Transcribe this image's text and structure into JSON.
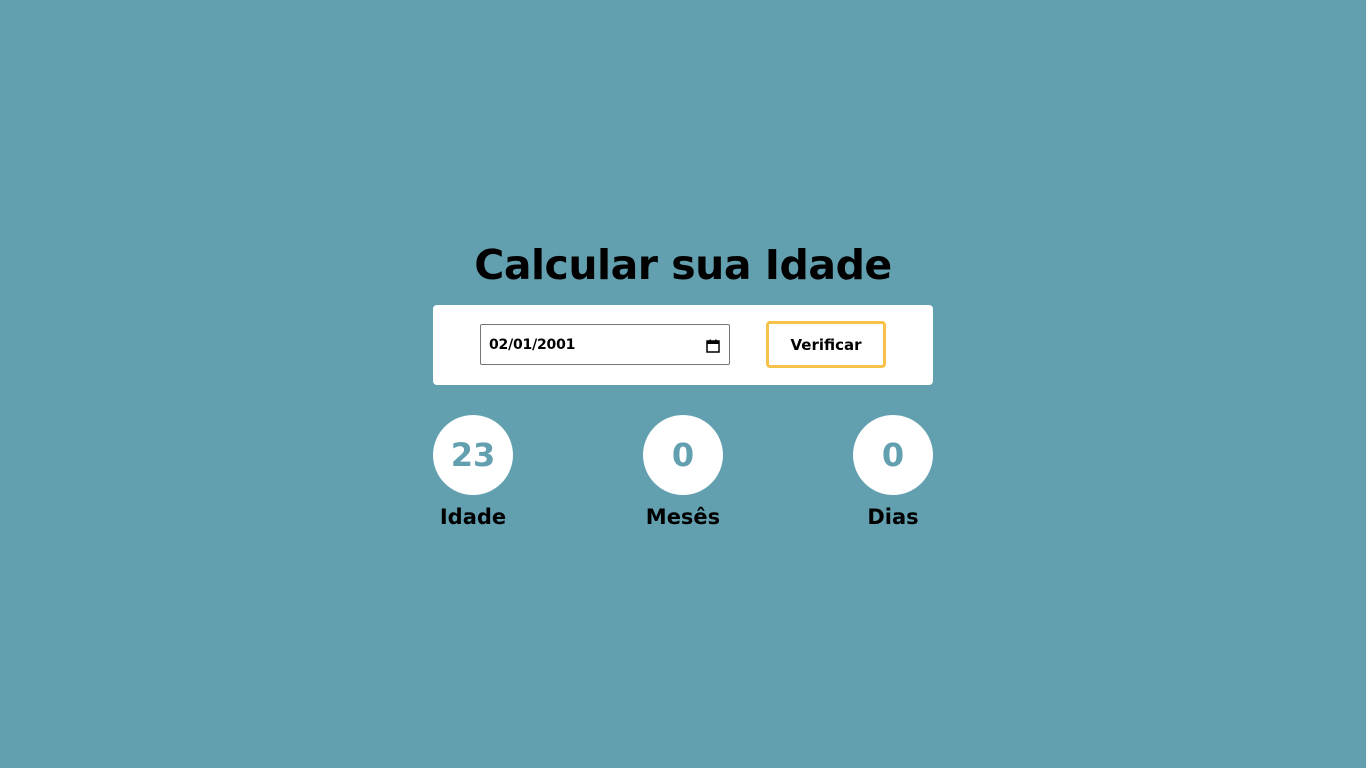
{
  "page": {
    "title": "Calcular sua Idade",
    "background_color": "#62a0b0",
    "accent_color": "#f6c24c"
  },
  "form": {
    "date_value": "02/01/2001",
    "calendar_icon": "calendar-icon",
    "verify_label": "Verificar"
  },
  "results": [
    {
      "value": "23",
      "label": "Idade"
    },
    {
      "value": "0",
      "label": "Mesês"
    },
    {
      "value": "0",
      "label": "Dias"
    }
  ]
}
